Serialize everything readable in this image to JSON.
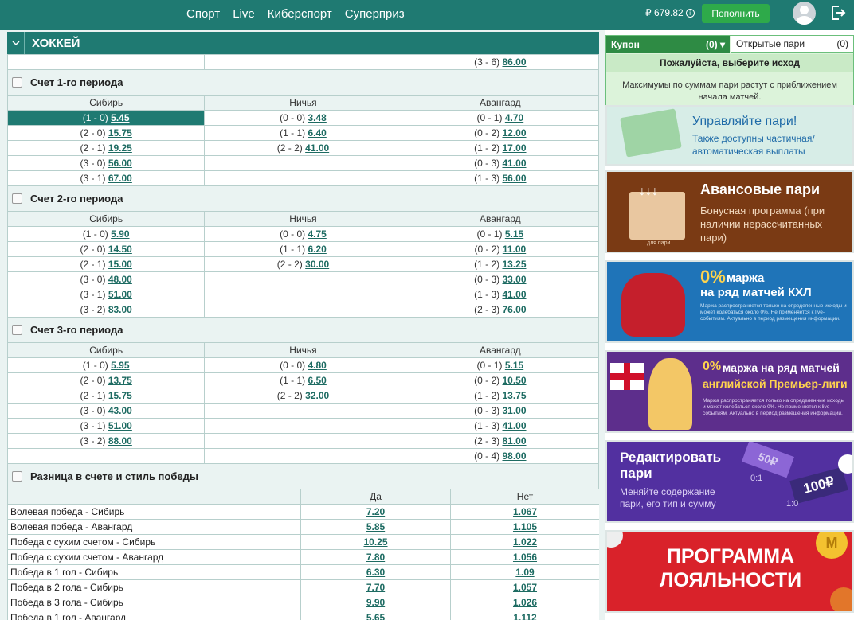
{
  "nav": {
    "items": [
      "Спорт",
      "Live",
      "Киберспорт",
      "Суперприз"
    ]
  },
  "account": {
    "balance": "₽ 679.82",
    "info_glyph": "i",
    "topup_label": "Пополнить"
  },
  "event": {
    "sport_title": "ХОККЕЙ",
    "top_row": {
      "score": "(3 - 6)",
      "odds": "86.00"
    }
  },
  "period1": {
    "title": "Счет 1-го периода",
    "cols": [
      "Сибирь",
      "Ничья",
      "Авангард"
    ],
    "rows": [
      [
        [
          "(1 - 0)",
          "5.45"
        ],
        [
          "(0 - 0)",
          "3.48"
        ],
        [
          "(0 - 1)",
          "4.70"
        ]
      ],
      [
        [
          "(2 - 0)",
          "15.75"
        ],
        [
          "(1 - 1)",
          "6.40"
        ],
        [
          "(0 - 2)",
          "12.00"
        ]
      ],
      [
        [
          "(2 - 1)",
          "19.25"
        ],
        [
          "(2 - 2)",
          "41.00"
        ],
        [
          "(1 - 2)",
          "17.00"
        ]
      ],
      [
        [
          "(3 - 0)",
          "56.00"
        ],
        [
          "",
          ""
        ],
        [
          "(0 - 3)",
          "41.00"
        ]
      ],
      [
        [
          "(3 - 1)",
          "67.00"
        ],
        [
          "",
          ""
        ],
        [
          "(1 - 3)",
          "56.00"
        ]
      ]
    ]
  },
  "period2": {
    "title": "Счет 2-го периода",
    "cols": [
      "Сибирь",
      "Ничья",
      "Авангард"
    ],
    "rows": [
      [
        [
          "(1 - 0)",
          "5.90"
        ],
        [
          "(0 - 0)",
          "4.75"
        ],
        [
          "(0 - 1)",
          "5.15"
        ]
      ],
      [
        [
          "(2 - 0)",
          "14.50"
        ],
        [
          "(1 - 1)",
          "6.20"
        ],
        [
          "(0 - 2)",
          "11.00"
        ]
      ],
      [
        [
          "(2 - 1)",
          "15.00"
        ],
        [
          "(2 - 2)",
          "30.00"
        ],
        [
          "(1 - 2)",
          "13.25"
        ]
      ],
      [
        [
          "(3 - 0)",
          "48.00"
        ],
        [
          "",
          ""
        ],
        [
          "(0 - 3)",
          "33.00"
        ]
      ],
      [
        [
          "(3 - 1)",
          "51.00"
        ],
        [
          "",
          ""
        ],
        [
          "(1 - 3)",
          "41.00"
        ]
      ],
      [
        [
          "(3 - 2)",
          "83.00"
        ],
        [
          "",
          ""
        ],
        [
          "(2 - 3)",
          "76.00"
        ]
      ]
    ]
  },
  "period3": {
    "title": "Счет 3-го периода",
    "cols": [
      "Сибирь",
      "Ничья",
      "Авангард"
    ],
    "rows": [
      [
        [
          "(1 - 0)",
          "5.95"
        ],
        [
          "(0 - 0)",
          "4.80"
        ],
        [
          "(0 - 1)",
          "5.15"
        ]
      ],
      [
        [
          "(2 - 0)",
          "13.75"
        ],
        [
          "(1 - 1)",
          "6.50"
        ],
        [
          "(0 - 2)",
          "10.50"
        ]
      ],
      [
        [
          "(2 - 1)",
          "15.75"
        ],
        [
          "(2 - 2)",
          "32.00"
        ],
        [
          "(1 - 2)",
          "13.75"
        ]
      ],
      [
        [
          "(3 - 0)",
          "43.00"
        ],
        [
          "",
          ""
        ],
        [
          "(0 - 3)",
          "31.00"
        ]
      ],
      [
        [
          "(3 - 1)",
          "51.00"
        ],
        [
          "",
          ""
        ],
        [
          "(1 - 3)",
          "41.00"
        ]
      ],
      [
        [
          "(3 - 2)",
          "88.00"
        ],
        [
          "",
          ""
        ],
        [
          "(2 - 3)",
          "81.00"
        ]
      ],
      [
        [
          "",
          ""
        ],
        [
          "",
          ""
        ],
        [
          "(0 - 4)",
          "98.00"
        ]
      ]
    ]
  },
  "diff": {
    "title": "Разница в счете и стиль победы",
    "cols": [
      "Да",
      "Нет"
    ],
    "rows": [
      [
        "Волевая победа - Сибирь",
        "7.20",
        "1.067"
      ],
      [
        "Волевая победа - Авангард",
        "5.85",
        "1.105"
      ],
      [
        "Победа с сухим счетом - Сибирь",
        "10.25",
        "1.022"
      ],
      [
        "Победа с сухим счетом - Авангард",
        "7.80",
        "1.056"
      ],
      [
        "Победа в 1 гол - Сибирь",
        "6.30",
        "1.09"
      ],
      [
        "Победа в 2 гола - Сибирь",
        "7.70",
        "1.057"
      ],
      [
        "Победа в 3 гола - Сибирь",
        "9.90",
        "1.026"
      ],
      [
        "Победа в 1 гол - Авангард",
        "5.65",
        "1.112"
      ]
    ]
  },
  "coupon": {
    "tab_label": "Купон",
    "tab_count": "(0)",
    "open_label": "Открытые пари",
    "open_count": "(0)",
    "prompt": "Пожалуйста, выберите исход",
    "note": "Максимумы по суммам пари растут с приближением начала матчей."
  },
  "banners": {
    "b1": {
      "title": "Управляйте пари!",
      "text": "Также доступны частичная/ автоматическая выплаты"
    },
    "b2": {
      "title": "Авансовые пари",
      "text": "Бонусная программа (при наличии нерассчитанных пари)",
      "mini": "для пари"
    },
    "b3": {
      "title_a": "0%",
      "title_b": "маржа",
      "title_c": "на ряд матчей КХЛ",
      "text": "Маржа распространяется только на определенные исходы и может колебаться около 0%. Не применяется к live-событиям. Актуально в период размещения информации."
    },
    "b4": {
      "title_a": "0%",
      "title_b": "маржа на ряд матчей",
      "title_c": "английской Премьер-лиги",
      "text": "Маржа распространяется только на определенные исходы и может колебаться около 0%. Не применяется к live-событиям. Актуально в период размещения информации."
    },
    "b5": {
      "title": "Редактировать пари",
      "text": "Меняйте содержание пари, его тип и сумму",
      "chip1": "50₽",
      "chip2": "100₽",
      "chip3": "0:1",
      "chip4": "1:0"
    },
    "b6": {
      "title": "ПРОГРАММА ЛОЯЛЬНОСТИ",
      "coin": "M"
    }
  },
  "colors": {
    "brand": "#1f7a72",
    "selected": "#1f7a72",
    "topup": "#2eaa4a",
    "coupon": "#2e8b44"
  }
}
